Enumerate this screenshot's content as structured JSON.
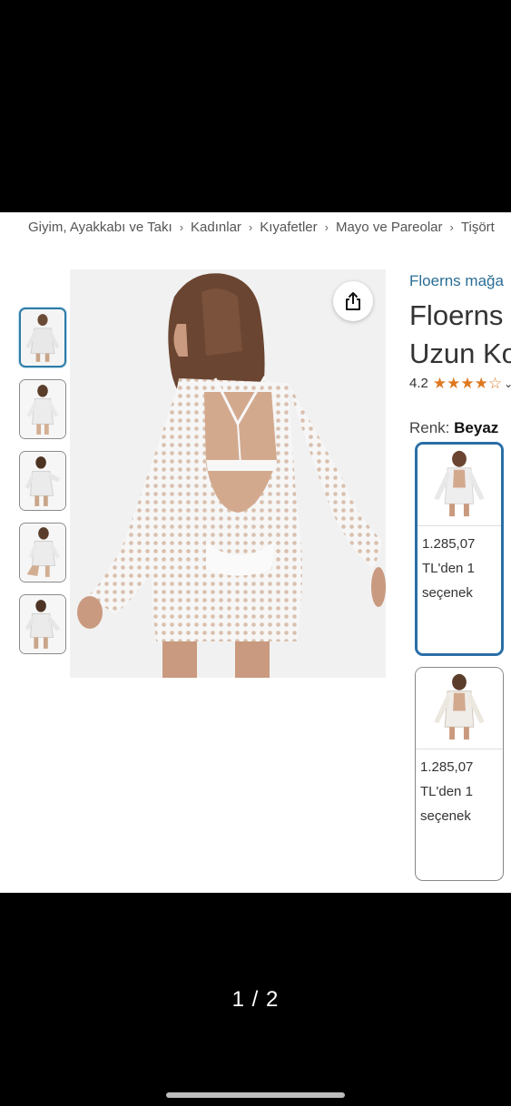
{
  "breadcrumb": [
    "Giyim, Ayakkabı ve Takı",
    "Kadınlar",
    "Kıyafetler",
    "Mayo ve Pareolar",
    "Tişört"
  ],
  "product": {
    "store_link": "Floerns mağa",
    "title_line1": "Floerns",
    "title_line2": "Uzun Ko",
    "rating_value": "4.2",
    "stars": [
      1,
      1,
      1,
      1,
      0
    ],
    "rating_more": "⌄",
    "color_label": "Renk: ",
    "color_value": "Beyaz"
  },
  "icons": {
    "share": "share-icon",
    "star": "star-icon"
  },
  "variants": [
    {
      "price_line1": "1.285,07",
      "price_line2": "TL'den 1",
      "price_line3": "seçenek",
      "selected": true
    },
    {
      "price_line1": "1.285,07",
      "price_line2": "TL'den 1",
      "price_line3": "seçenek",
      "selected": false
    }
  ],
  "thumbnails": [
    {
      "selected": true
    },
    {
      "selected": false
    },
    {
      "selected": false
    },
    {
      "selected": false
    },
    {
      "selected": false
    }
  ],
  "image_counter": "1 / 2",
  "colors": {
    "link": "#2a6e95",
    "star": "#de7921",
    "selected_border": "#2b6fa7"
  }
}
